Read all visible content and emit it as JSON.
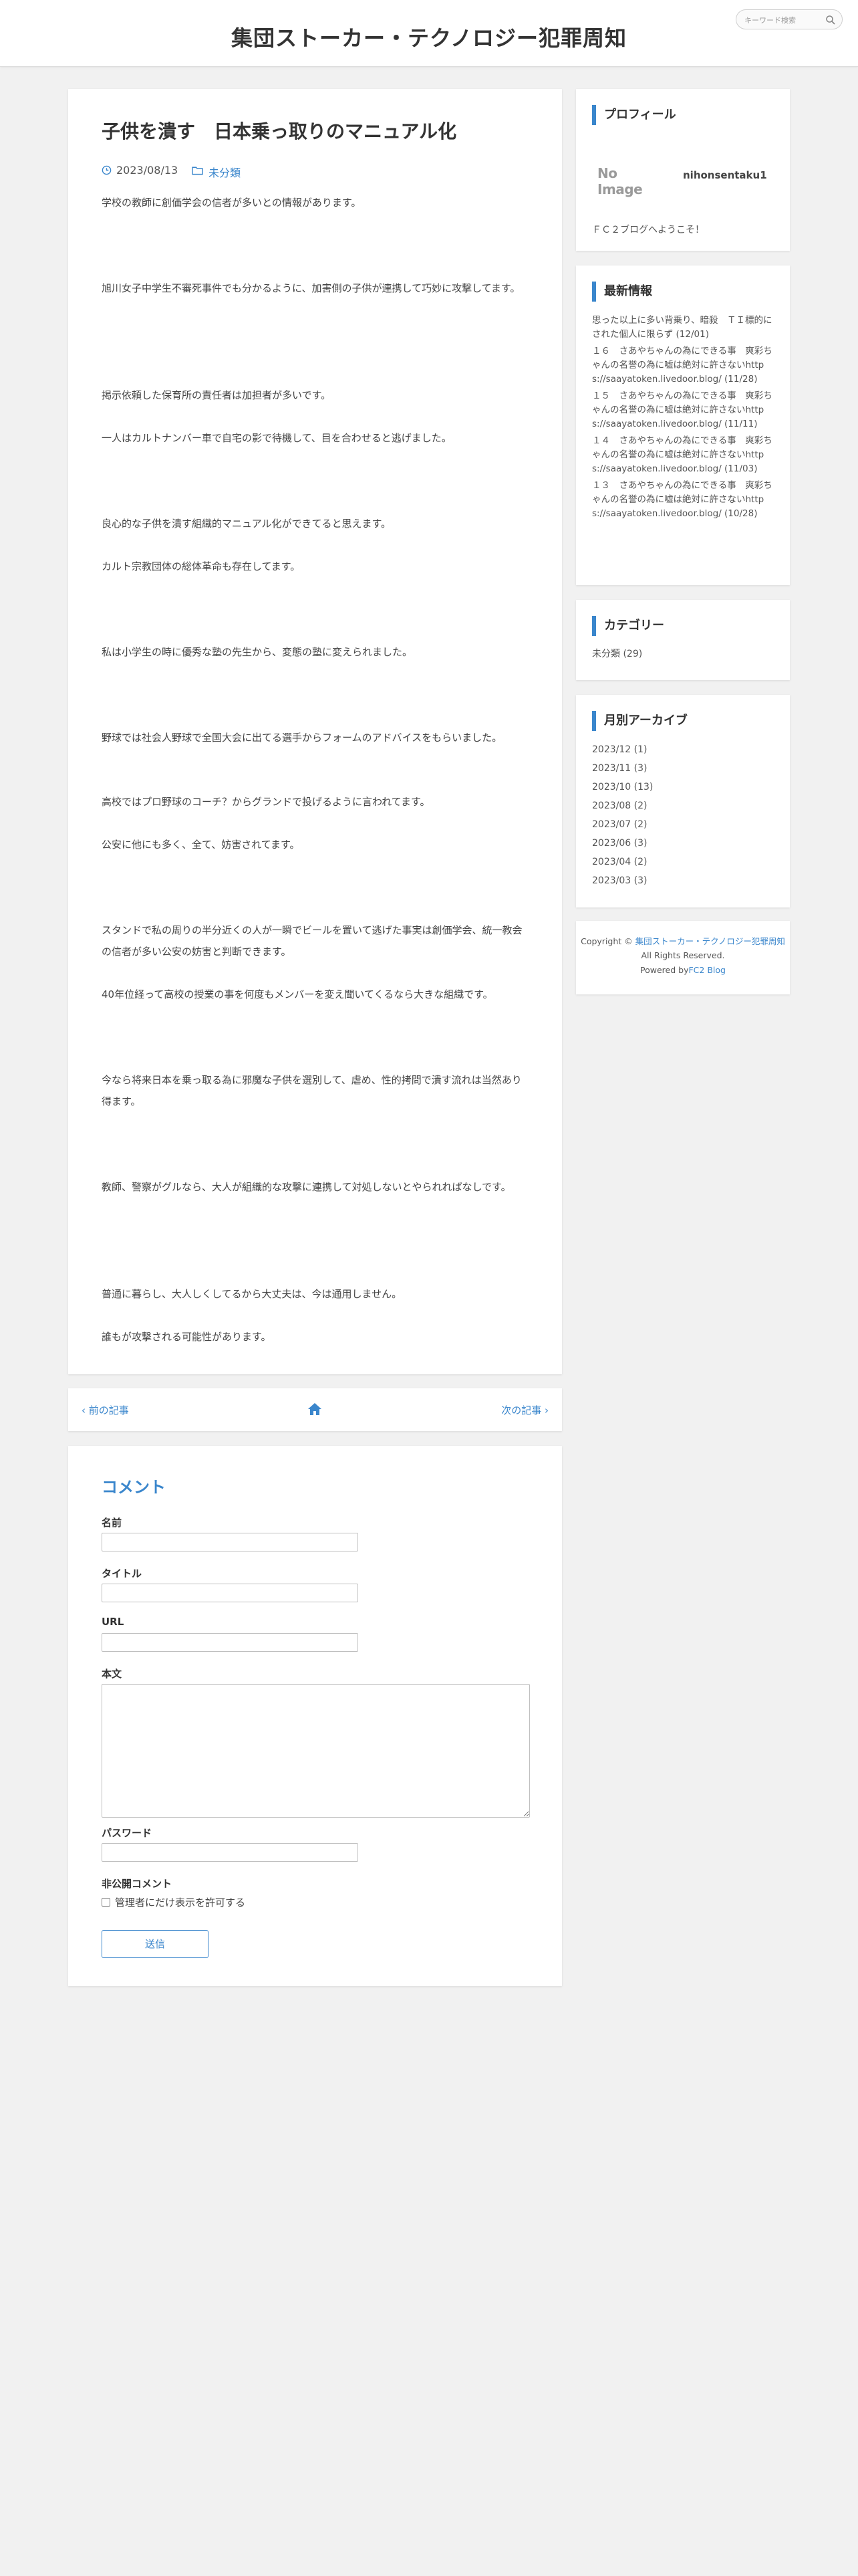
{
  "header": {
    "site_title": "集団ストーカー・テクノロジー犯罪周知",
    "search_placeholder": "キーワード検索"
  },
  "article": {
    "title": "子供を潰す　日本乗っ取りのマニュアル化",
    "date": "2023/08/13",
    "category": "未分類",
    "paragraphs": [
      "学校の教師に創価学会の信者が多いとの情報があります。",
      "旭川女子中学生不審死事件でも分かるように、加害側の子供が連携して巧妙に攻撃してます。",
      "掲示依頼した保育所の責任者は加担者が多いです。",
      "一人はカルトナンバー車で自宅の影で待機して、目を合わせると逃げました。",
      "良心的な子供を潰す組織的マニュアル化ができてると思えます。",
      "カルト宗教団体の総体革命も存在してます。",
      "私は小学生の時に優秀な塾の先生から、変態の塾に変えられました。",
      "野球では社会人野球で全国大会に出てる選手からフォームのアドバイスをもらいました。",
      "高校ではプロ野球のコーチ？からグランドで投げるように言われてます。",
      "公安に他にも多く、全て、妨害されてます。",
      "スタンドで私の周りの半分近くの人が一瞬でビールを置いて逃げた事実は創価学会、統一教会の信者が多い公安の妨害と判断できます。",
      "40年位経って高校の授業の事を何度もメンバーを変え聞いてくるなら大きな組織です。",
      "今なら将来日本を乗っ取る為に邪魔な子供を選別して、虐め、性的拷問で潰す流れは当然あり得ます。",
      "教師、警察がグルなら、大人が組織的な攻撃に連携して対処しないとやられればなしです。",
      "普通に暮らし、大人しくしてるから大丈夫は、今は通用しません。",
      "誰もが攻撃される可能性があります。"
    ]
  },
  "postnav": {
    "prev": "前の記事",
    "next": "次の記事"
  },
  "comment": {
    "title": "コメント",
    "name_label": "名前",
    "title_label": "タイトル",
    "url_label": "URL",
    "body_label": "本文",
    "password_label": "パスワード",
    "private_label": "非公開コメント",
    "private_checkbox": "管理者にだけ表示を許可する",
    "submit": "送信"
  },
  "sidebar": {
    "profile": {
      "heading": "プロフィール",
      "no_image": "No Image",
      "name": "nihonsentaku1",
      "message": "ＦＣ２ブログへようこそ！"
    },
    "news": {
      "heading": "最新情報",
      "items": [
        "思った以上に多い背乗り、暗殺　ＴＩ標的にされた個人に限らず (12/01)",
        "１６　さあやちゃんの為にできる事　爽彩ちゃんの名誉の為に嘘は絶対に許さないhttps://saayatoken.livedoor.blog/ (11/28)",
        "１５　さあやちゃんの為にできる事　爽彩ちゃんの名誉の為に嘘は絶対に許さないhttps://saayatoken.livedoor.blog/ (11/11)",
        "１４　さあやちゃんの為にできる事　爽彩ちゃんの名誉の為に嘘は絶対に許さないhttps://saayatoken.livedoor.blog/ (11/03)",
        "１３　さあやちゃんの為にできる事　爽彩ちゃんの名誉の為に嘘は絶対に許さないhttps://saayatoken.livedoor.blog/ (10/28)"
      ]
    },
    "categories": {
      "heading": "カテゴリー",
      "item": "未分類 (29)"
    },
    "archives": {
      "heading": "月別アーカイブ",
      "items": [
        "2023/12 (1)",
        "2023/11 (3)",
        "2023/10 (13)",
        "2023/08 (2)",
        "2023/07 (2)",
        "2023/06 (3)",
        "2023/04 (2)",
        "2023/03 (3)"
      ]
    },
    "footer": {
      "copyright_prefix": "Copyright © ",
      "site_link": "集団ストーカー・テクノロジー犯罪周知",
      "rights": "All Rights Reserved.",
      "powered_prefix": "Powered by",
      "powered_link": "FC2 Blog"
    }
  },
  "colors": {
    "accent": "#3a86cc",
    "background": "#f1f1f1"
  }
}
